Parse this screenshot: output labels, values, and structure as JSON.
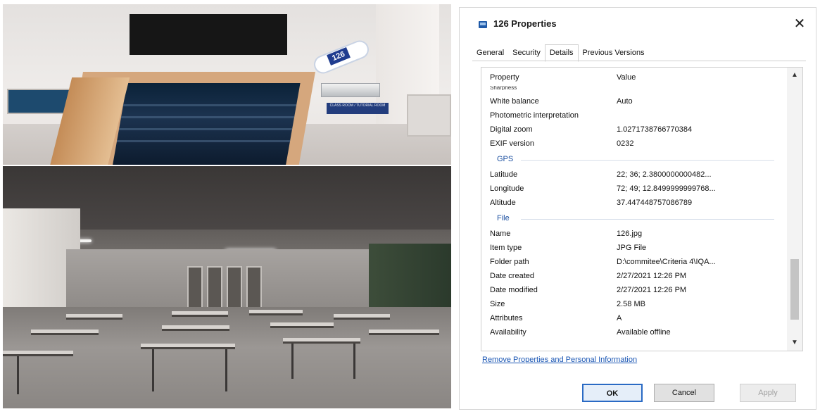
{
  "photos": {
    "room_sign_number": "126",
    "door_plate_text": "CLASS ROOM / TUTORIAL ROOM"
  },
  "dialog": {
    "title": "126 Properties",
    "close_label": "✕",
    "tabs": [
      {
        "label": "General"
      },
      {
        "label": "Security"
      },
      {
        "label": "Details"
      },
      {
        "label": "Previous Versions"
      }
    ],
    "active_tab": "Details",
    "columns": {
      "property": "Property",
      "value": "Value"
    },
    "clipped_row": "Sharpness",
    "rows_camera": [
      {
        "k": "White balance",
        "v": "Auto"
      },
      {
        "k": "Photometric interpretation",
        "v": ""
      },
      {
        "k": "Digital zoom",
        "v": "1.0271738766770384"
      },
      {
        "k": "EXIF version",
        "v": "0232"
      }
    ],
    "group_gps": "GPS",
    "rows_gps": [
      {
        "k": "Latitude",
        "v": "22; 36; 2.3800000000482..."
      },
      {
        "k": "Longitude",
        "v": "72; 49; 12.8499999999768..."
      },
      {
        "k": "Altitude",
        "v": "37.447448757086789"
      }
    ],
    "group_file": "File",
    "rows_file": [
      {
        "k": "Name",
        "v": "126.jpg"
      },
      {
        "k": "Item type",
        "v": "JPG File"
      },
      {
        "k": "Folder path",
        "v": "D:\\commitee\\Criteria 4\\IQA..."
      },
      {
        "k": "Date created",
        "v": "2/27/2021 12:26 PM"
      },
      {
        "k": "Date modified",
        "v": "2/27/2021 12:26 PM"
      },
      {
        "k": "Size",
        "v": "2.58 MB"
      },
      {
        "k": "Attributes",
        "v": "A"
      },
      {
        "k": "Availability",
        "v": "Available offline"
      }
    ],
    "remove_link": "Remove Properties and Personal Information",
    "buttons": {
      "ok": "OK",
      "cancel": "Cancel",
      "apply": "Apply"
    }
  }
}
